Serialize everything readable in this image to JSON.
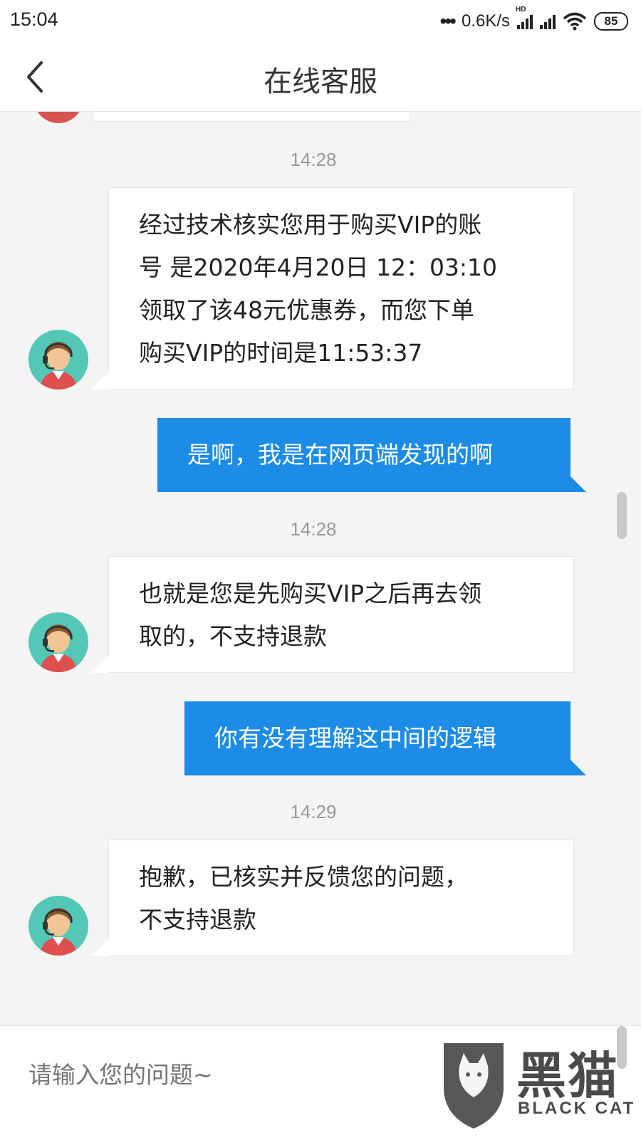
{
  "status_bar": {
    "time": "15:04",
    "net_speed": "0.6K/s",
    "hd_label": "HD",
    "battery": "85"
  },
  "header": {
    "title": "在线客服",
    "back_icon": "chevron-left-icon"
  },
  "messages": [
    {
      "type": "timestamp",
      "text": "14:28"
    },
    {
      "type": "agent",
      "lines": [
        "经过技术核实您用于购买VIP的账",
        "号 是2020年4月20日 12：03:10",
        "领取了该48元优惠券，而您下单",
        "购买VIP的时间是11:53:37"
      ]
    },
    {
      "type": "user",
      "text": "是啊，我是在网页端发现的啊"
    },
    {
      "type": "timestamp",
      "text": "14:28"
    },
    {
      "type": "agent",
      "lines": [
        "也就是您是先购买VIP之后再去领",
        "取的，不支持退款"
      ]
    },
    {
      "type": "user",
      "text": "你有没有理解这中间的逻辑"
    },
    {
      "type": "timestamp",
      "text": "14:29"
    },
    {
      "type": "agent",
      "lines": [
        "抱歉，已核实并反馈您的问题，",
        "不支持退款"
      ]
    }
  ],
  "input": {
    "placeholder": "请输入您的问题~"
  },
  "watermark": {
    "cn": "黑猫",
    "en": "BLACK CAT"
  },
  "colors": {
    "user_bubble": "#1c8ce6",
    "avatar_bg": "#55c7b6",
    "background": "#f4f4f4"
  }
}
